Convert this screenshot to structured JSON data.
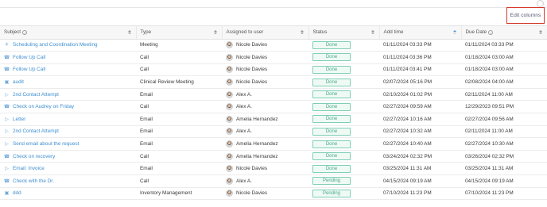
{
  "toolbar": {
    "edit_columns_label": "Edit columns",
    "accent_color": "#d43a2a"
  },
  "columns": [
    {
      "label": "Subject",
      "info": true,
      "sort": "none"
    },
    {
      "label": "Type",
      "info": false,
      "sort": "none"
    },
    {
      "label": "Assigned to user",
      "info": false,
      "sort": "none"
    },
    {
      "label": "Status",
      "info": false,
      "sort": "none"
    },
    {
      "label": "Add time",
      "info": false,
      "sort": "ascending"
    },
    {
      "label": "Due Date",
      "info": true,
      "sort": "none"
    }
  ],
  "rows": [
    {
      "icon": "meeting-icon",
      "subject": "Scheduling and Coordination Meeting",
      "type": "Meeting",
      "user": "Nicole Davies",
      "status": "Done",
      "added": "01/11/2024 03:33 PM",
      "due": "01/11/2024 03:33 PM"
    },
    {
      "icon": "phone-icon",
      "subject": "Follow Up Call",
      "type": "Call",
      "user": "Nicole Davies",
      "status": "Done",
      "added": "01/11/2024 03:36 PM",
      "due": "01/18/2024 03:00 AM"
    },
    {
      "icon": "phone-icon",
      "subject": "Follow Up Call",
      "type": "Call",
      "user": "Nicole Davies",
      "status": "Done",
      "added": "01/11/2024 03:41 PM",
      "due": "01/18/2024 03:00 AM"
    },
    {
      "icon": "calendar-icon",
      "subject": "audit",
      "type": "Clinical Review Meeting",
      "user": "Nicole Davies",
      "status": "Done",
      "added": "02/07/2024 05:16 PM",
      "due": "02/08/2024 04:00 AM"
    },
    {
      "icon": "send-icon",
      "subject": "2nd Contact Attempt",
      "type": "Email",
      "user": "Alex A.",
      "status": "Done",
      "added": "02/10/2024 01:02 PM",
      "due": "02/11/2024 11:00 AM"
    },
    {
      "icon": "phone-icon",
      "subject": "Check on Audrey on Friday",
      "type": "Call",
      "user": "Alex A.",
      "status": "Done",
      "added": "02/27/2024 09:59 AM",
      "due": "12/29/2023 09:51 PM"
    },
    {
      "icon": "send-icon",
      "subject": "Letter",
      "type": "Email",
      "user": "Amelia Hernandez",
      "status": "Done",
      "added": "02/27/2024 10:16 AM",
      "due": "02/27/2024 09:56 AM"
    },
    {
      "icon": "send-icon",
      "subject": "2nd Contact Attempt",
      "type": "Email",
      "user": "Alex A.",
      "status": "Done",
      "added": "02/27/2024 10:32 AM",
      "due": "02/11/2024 11:00 AM"
    },
    {
      "icon": "send-icon",
      "subject": "Send email about the request",
      "type": "Email",
      "user": "Amelia Hernandez",
      "status": "Done",
      "added": "02/27/2024 10:40 AM",
      "due": "02/27/2024 10:30 AM"
    },
    {
      "icon": "phone-icon",
      "subject": "Check on recovery",
      "type": "Call",
      "user": "Amelia Hernandez",
      "status": "Done",
      "added": "03/24/2024 02:32 PM",
      "due": "03/26/2024 02:32 PM"
    },
    {
      "icon": "send-icon",
      "subject": "Email: Invoice",
      "type": "Email",
      "user": "Nicole Davies",
      "status": "Done",
      "added": "03/25/2024 11:31 AM",
      "due": "03/25/2024 11:31 AM"
    },
    {
      "icon": "phone-icon",
      "subject": "Check with the Dr.",
      "type": "Call",
      "user": "Alex A.",
      "status": "Pending",
      "added": "04/15/2024 09:19 AM",
      "due": "04/15/2024 09:19 AM"
    },
    {
      "icon": "calendar-icon",
      "subject": "ddd",
      "type": "Inventory Management",
      "user": "Nicole Davies",
      "status": "Pending",
      "added": "07/10/2024 11:23 PM",
      "due": "07/10/2024 11:23 PM"
    }
  ]
}
